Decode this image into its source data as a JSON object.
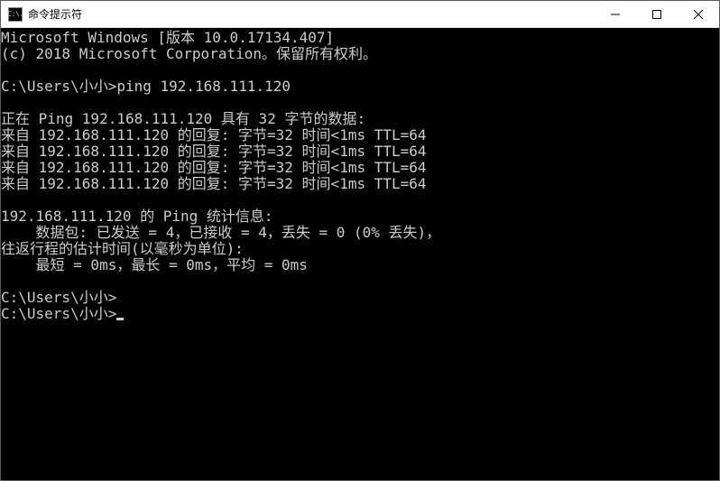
{
  "window": {
    "title": "命令提示符",
    "icon_text": "C:\\."
  },
  "console": {
    "lines": [
      "Microsoft Windows [版本 10.0.17134.407]",
      "(c) 2018 Microsoft Corporation。保留所有权利。",
      "",
      "C:\\Users\\小小>ping 192.168.111.120",
      "",
      "正在 Ping 192.168.111.120 具有 32 字节的数据:",
      "来自 192.168.111.120 的回复: 字节=32 时间<1ms TTL=64",
      "来自 192.168.111.120 的回复: 字节=32 时间<1ms TTL=64",
      "来自 192.168.111.120 的回复: 字节=32 时间<1ms TTL=64",
      "来自 192.168.111.120 的回复: 字节=32 时间<1ms TTL=64",
      "",
      "192.168.111.120 的 Ping 统计信息:",
      "    数据包: 已发送 = 4，已接收 = 4，丢失 = 0 (0% 丢失)，",
      "往返行程的估计时间(以毫秒为单位):",
      "    最短 = 0ms，最长 = 0ms，平均 = 0ms",
      "",
      "C:\\Users\\小小>",
      "C:\\Users\\小小>"
    ]
  }
}
